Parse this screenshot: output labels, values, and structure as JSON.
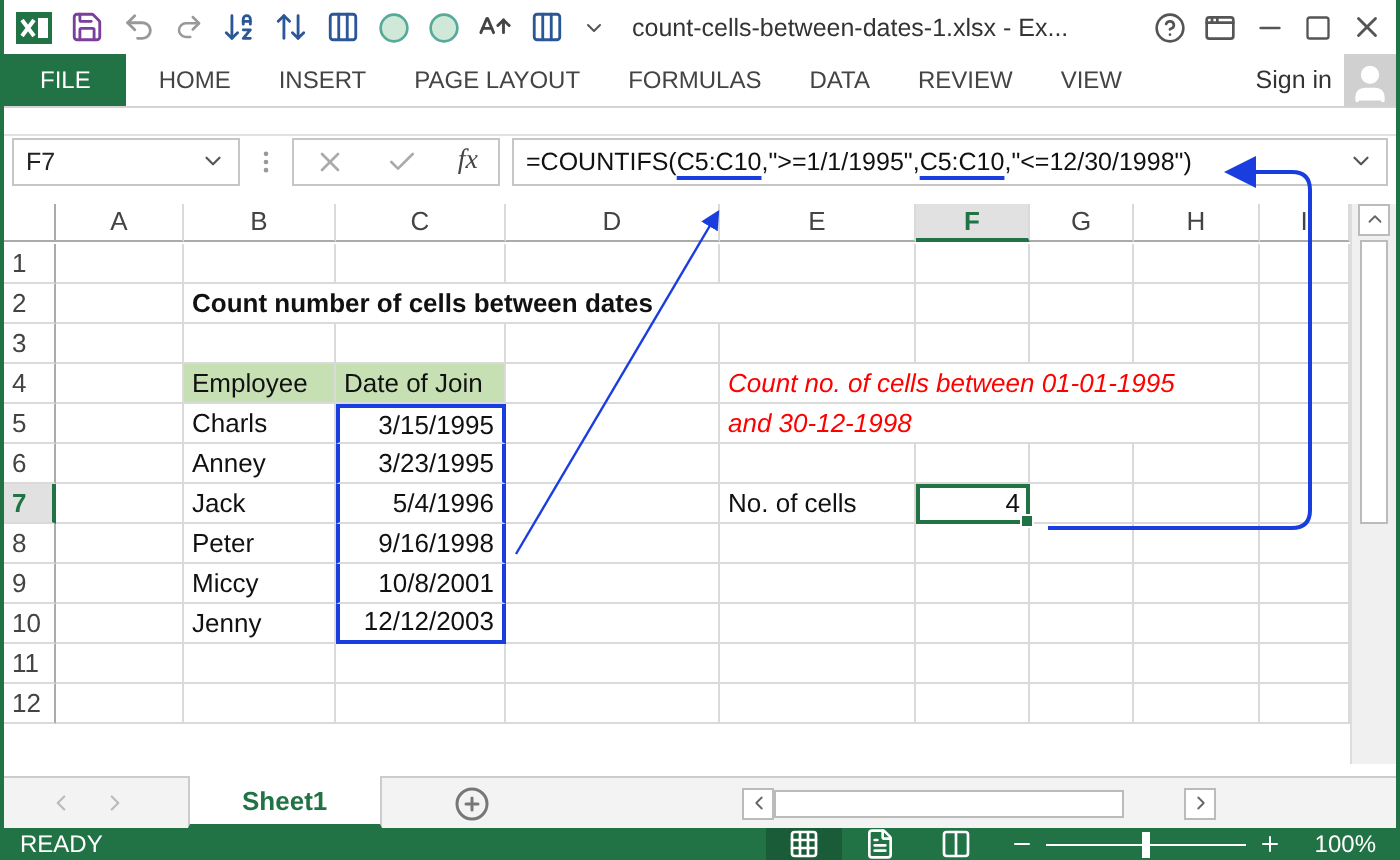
{
  "window": {
    "title": "count-cells-between-dates-1.xlsx - Ex..."
  },
  "ribbon": {
    "tabs": [
      {
        "label": "FILE",
        "kind": "file",
        "selected": false
      },
      {
        "label": "HOME",
        "kind": "tab",
        "selected": false
      },
      {
        "label": "INSERT",
        "kind": "tab",
        "selected": false
      },
      {
        "label": "PAGE LAYOUT",
        "kind": "tab",
        "selected": false
      },
      {
        "label": "FORMULAS",
        "kind": "tab",
        "selected": false
      },
      {
        "label": "DATA",
        "kind": "tab",
        "selected": false
      },
      {
        "label": "REVIEW",
        "kind": "tab",
        "selected": false
      },
      {
        "label": "VIEW",
        "kind": "tab",
        "selected": false
      }
    ],
    "sign_in": "Sign in"
  },
  "formula_bar": {
    "name_box": "F7",
    "function_label": "fx",
    "formula": [
      {
        "text": "=COUNTIFS(",
        "kind": "plain"
      },
      {
        "text": "C5:C10",
        "kind": "ref"
      },
      {
        "text": ",\">=1/1/1995\",",
        "kind": "plain"
      },
      {
        "text": "C5:C10",
        "kind": "ref"
      },
      {
        "text": ",\"<=12/30/1998\")",
        "kind": "plain"
      }
    ]
  },
  "sheet": {
    "columns": [
      {
        "label": "A",
        "selected": false
      },
      {
        "label": "B",
        "selected": false
      },
      {
        "label": "C",
        "selected": false
      },
      {
        "label": "D",
        "selected": false
      },
      {
        "label": "E",
        "selected": false
      },
      {
        "label": "F",
        "selected": true
      },
      {
        "label": "G",
        "selected": false
      },
      {
        "label": "H",
        "selected": false
      },
      {
        "label": "I",
        "selected": false
      }
    ],
    "rows": [
      {
        "label": "1",
        "selected": false
      },
      {
        "label": "2",
        "selected": false,
        "B": {
          "text": "Count number of cells between dates",
          "kind": "title"
        }
      },
      {
        "label": "3",
        "selected": false
      },
      {
        "label": "4",
        "selected": false,
        "B": {
          "text": "Employee",
          "kind": "header"
        },
        "C": {
          "text": "Date of Join",
          "kind": "header"
        },
        "E": {
          "text": "Count no. of cells between 01-01-1995",
          "kind": "note"
        }
      },
      {
        "label": "5",
        "selected": false,
        "B": {
          "text": "Charls",
          "kind": "text"
        },
        "C": {
          "text": "3/15/1995",
          "kind": "range"
        },
        "E": {
          "text": "and 30-12-1998",
          "kind": "note"
        }
      },
      {
        "label": "6",
        "selected": false,
        "B": {
          "text": "Anney",
          "kind": "text"
        },
        "C": {
          "text": "3/23/1995",
          "kind": "range"
        }
      },
      {
        "label": "7",
        "selected": true,
        "B": {
          "text": "Jack",
          "kind": "text"
        },
        "C": {
          "text": "5/4/1996",
          "kind": "range"
        },
        "E": {
          "text": "No. of cells",
          "kind": "text"
        },
        "F": {
          "text": "4",
          "kind": "number",
          "selected": true
        }
      },
      {
        "label": "8",
        "selected": false,
        "B": {
          "text": "Peter",
          "kind": "text"
        },
        "C": {
          "text": "9/16/1998",
          "kind": "range"
        }
      },
      {
        "label": "9",
        "selected": false,
        "B": {
          "text": "Miccy",
          "kind": "text"
        },
        "C": {
          "text": "10/8/2001",
          "kind": "range"
        }
      },
      {
        "label": "10",
        "selected": false,
        "B": {
          "text": "Jenny",
          "kind": "text"
        },
        "C": {
          "text": "12/12/2003",
          "kind": "range"
        }
      },
      {
        "label": "11",
        "selected": false
      },
      {
        "label": "12",
        "selected": false
      }
    ]
  },
  "sheet_tabs": [
    {
      "label": "Sheet1",
      "selected": true
    }
  ],
  "status_bar": {
    "text": "READY",
    "view_modes": [
      {
        "kind": "normal",
        "selected": true
      },
      {
        "kind": "page_layout",
        "selected": false
      },
      {
        "kind": "page_break",
        "selected": false
      }
    ],
    "zoom": {
      "level": 0.5,
      "reading": "100%"
    }
  }
}
